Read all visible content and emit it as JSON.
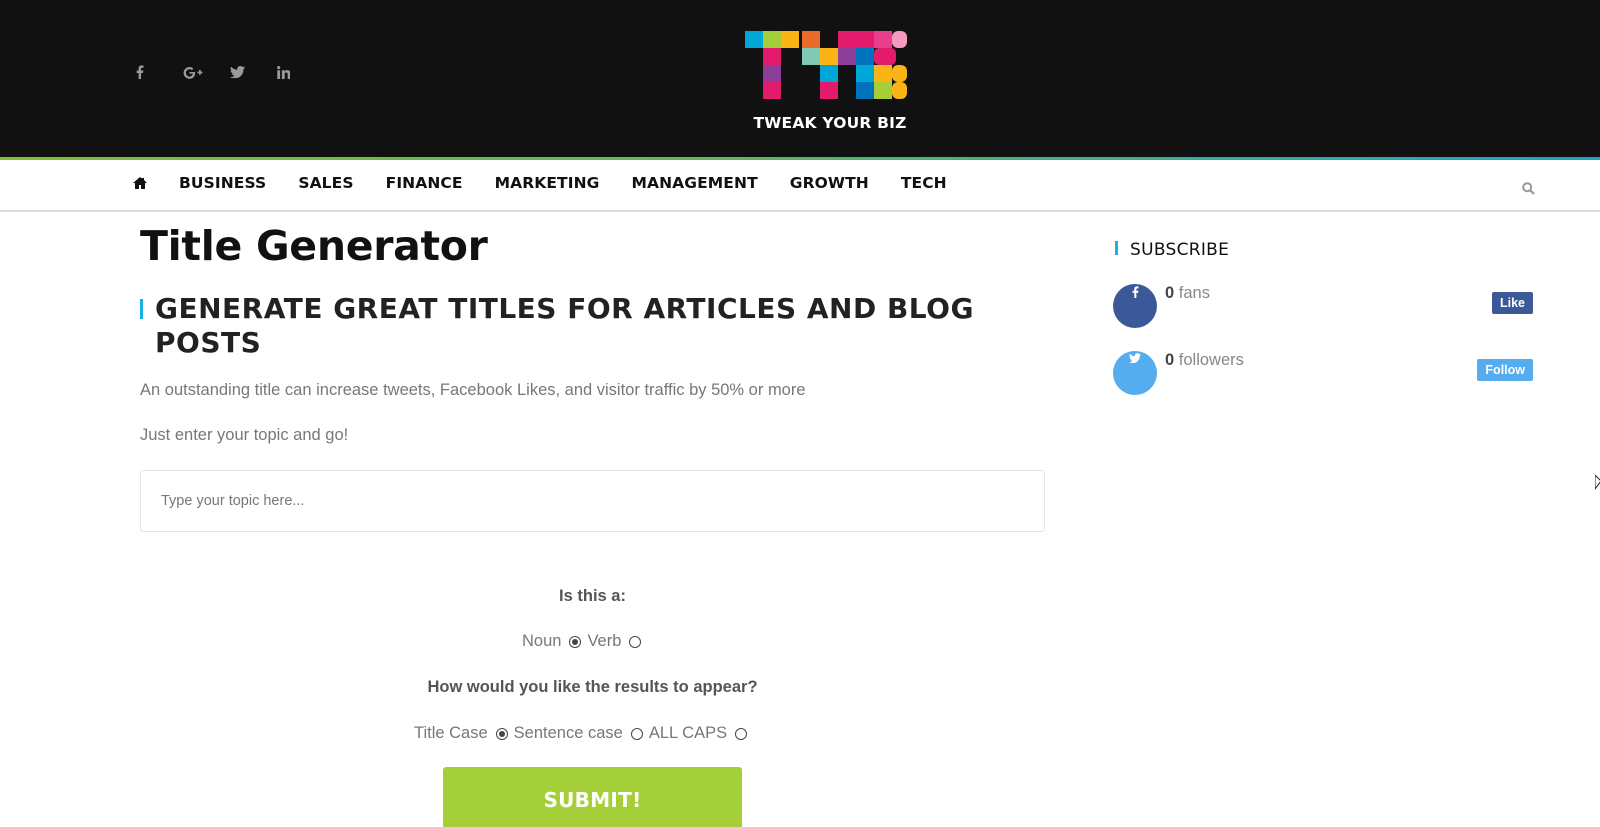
{
  "header": {
    "social_icons": [
      "facebook-icon",
      "google-plus-icon",
      "twitter-icon",
      "linkedin-icon"
    ],
    "logo_letters": "TYB",
    "logo_text": "TWEAK YOUR BIZ"
  },
  "nav": {
    "home_icon": "home-icon",
    "items": [
      "BUSINESS",
      "SALES",
      "FINANCE",
      "MARKETING",
      "MANAGEMENT",
      "GROWTH",
      "TECH"
    ],
    "search_icon": "search-icon"
  },
  "main": {
    "title": "Title Generator",
    "subtitle": "GENERATE GREAT TITLES FOR ARTICLES AND BLOG POSTS",
    "intro": "An outstanding title can increase tweets, Facebook Likes, and visitor traffic by 50% or more",
    "intro2": "Just enter your topic and go!",
    "topic_placeholder": "Type your topic here...",
    "topic_value": "",
    "question1": "Is this a:",
    "word_type_options": [
      {
        "label": "Noun",
        "selected": true
      },
      {
        "label": "Verb",
        "selected": false
      }
    ],
    "question2": "How would you like the results to appear?",
    "case_options": [
      {
        "label": "Title Case",
        "selected": true
      },
      {
        "label": "Sentence case",
        "selected": false
      },
      {
        "label": "ALL CAPS",
        "selected": false
      }
    ],
    "submit_label": "SUBMIT!"
  },
  "sidebar": {
    "title": "SUBSCRIBE",
    "facebook": {
      "count": "0",
      "unit": "fans",
      "button": "Like",
      "color": "#3b5998"
    },
    "twitter": {
      "count": "0",
      "unit": "followers",
      "button": "Follow",
      "color": "#55acee"
    }
  },
  "colors": {
    "header_bg": "#111111",
    "accent_blue": "#1ab0e8",
    "submit_green": "#a5cf39"
  }
}
